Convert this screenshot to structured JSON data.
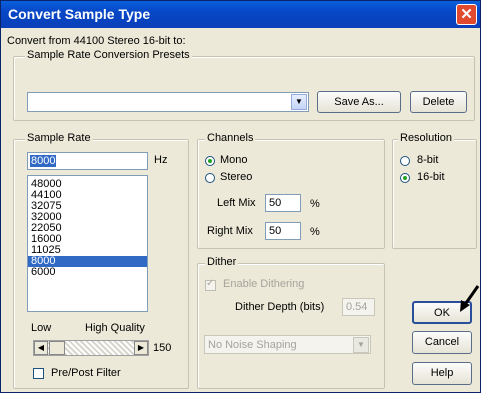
{
  "title": "Convert Sample Type",
  "close_symbol": "✕",
  "intro": "Convert from 44100 Stereo 16-bit to:",
  "presets": {
    "label": "Sample Rate Conversion Presets",
    "value": "",
    "save_label": "Save As...",
    "delete_label": "Delete"
  },
  "sample_rate": {
    "label": "Sample Rate",
    "value": "8000",
    "unit": "Hz",
    "items": [
      "48000",
      "44100",
      "32075",
      "32000",
      "22050",
      "16000",
      "11025",
      "8000",
      "6000"
    ],
    "selected": "8000",
    "low_label": "Low",
    "high_label": "High Quality",
    "quality_value": "150",
    "pre_post_label": "Pre/Post Filter"
  },
  "channels": {
    "label": "Channels",
    "mono_label": "Mono",
    "stereo_label": "Stereo",
    "selected": "Mono",
    "left_mix_label": "Left Mix",
    "left_mix_value": "50",
    "right_mix_label": "Right Mix",
    "right_mix_value": "50",
    "percent": "%"
  },
  "resolution": {
    "label": "Resolution",
    "opt8_label": "8-bit",
    "opt16_label": "16-bit",
    "selected": "16-bit"
  },
  "dither": {
    "label": "Dither",
    "enable_label": "Enable Dithering",
    "depth_label": "Dither Depth (bits)",
    "depth_value": "0.54",
    "shaping_value": "No Noise Shaping"
  },
  "buttons": {
    "ok": "OK",
    "cancel": "Cancel",
    "help": "Help"
  },
  "colors": {
    "titlebar": "#0747c6",
    "selection": "#316ac5",
    "close": "#e24a2d"
  }
}
